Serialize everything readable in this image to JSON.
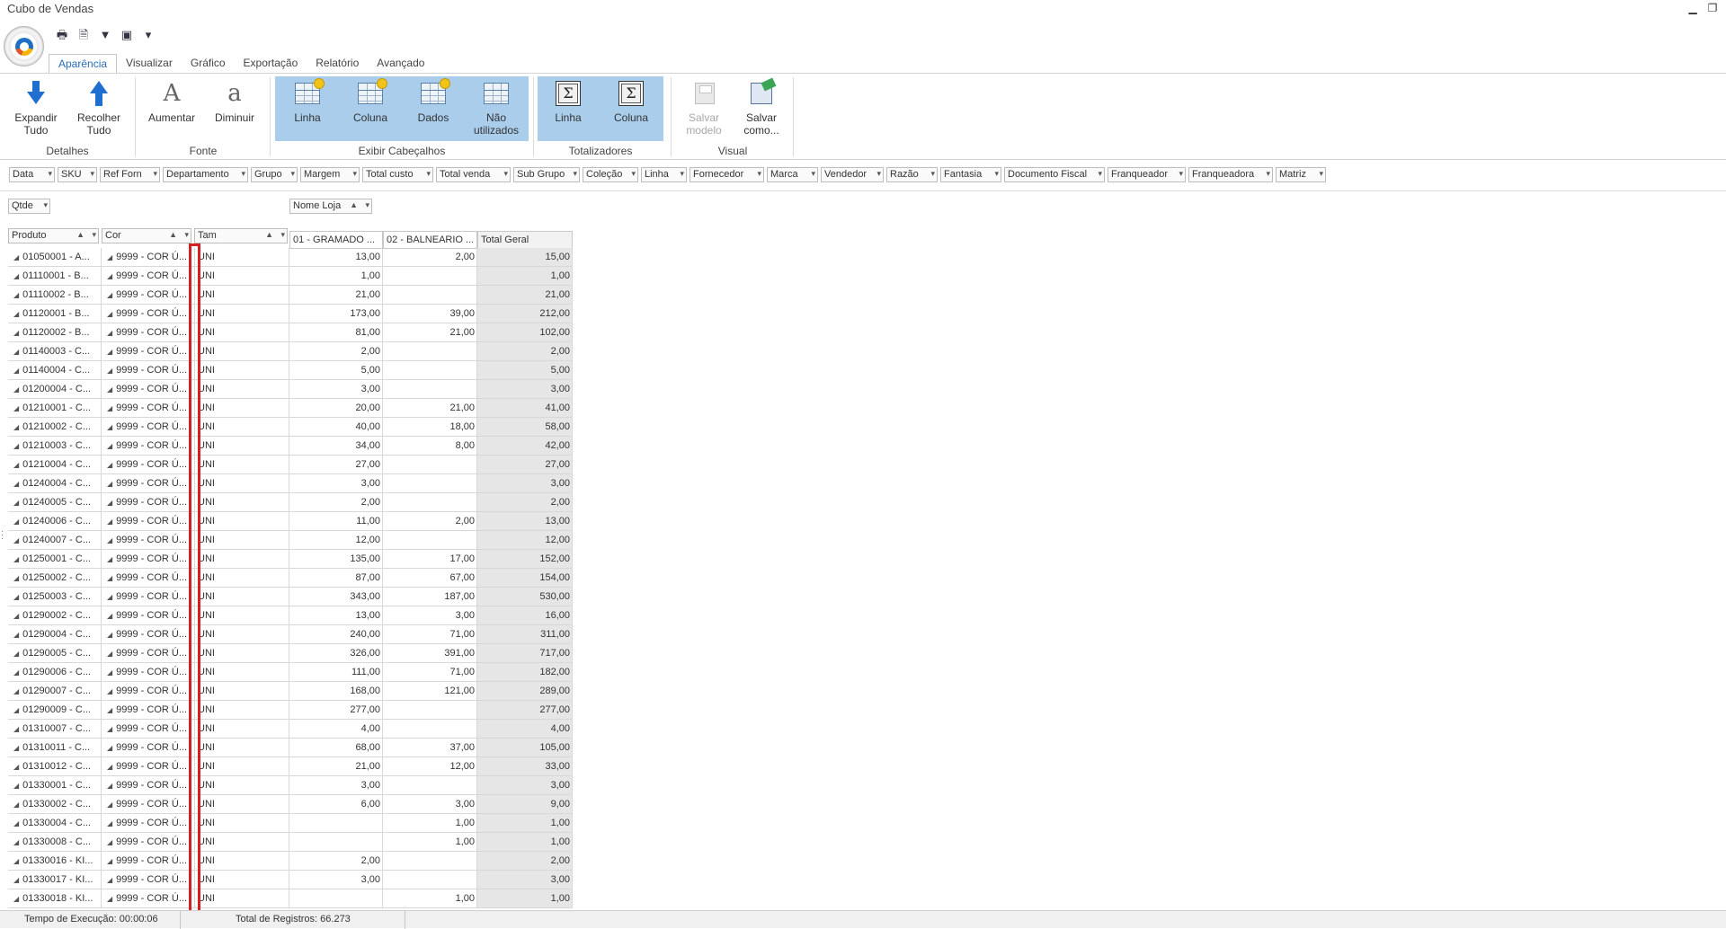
{
  "window": {
    "title": "Cubo de Vendas",
    "minimize_glyph": "▁",
    "restore_glyph": "❐"
  },
  "quick_access": [
    {
      "name": "print-icon",
      "glyph": "🖶"
    },
    {
      "name": "preview-icon",
      "glyph": "🗎"
    },
    {
      "name": "filter-icon",
      "glyph": "▼"
    },
    {
      "name": "export-icon",
      "glyph": "▣"
    },
    {
      "name": "customize-qat-icon",
      "glyph": "▾"
    }
  ],
  "tabs": [
    {
      "label": "Aparência",
      "active": true
    },
    {
      "label": "Visualizar"
    },
    {
      "label": "Gráfico"
    },
    {
      "label": "Exportação"
    },
    {
      "label": "Relatório"
    },
    {
      "label": "Avançado"
    }
  ],
  "ribbon": {
    "expand": {
      "l1": "Expandir",
      "l2": "Tudo"
    },
    "collapse": {
      "l1": "Recolher",
      "l2": "Tudo"
    },
    "grp_detalhes": "Detalhes",
    "increase": {
      "l1": "Aumentar"
    },
    "decrease": {
      "l1": "Diminuir"
    },
    "grp_fonte": "Fonte",
    "hdr_linha": "Linha",
    "hdr_coluna": "Coluna",
    "hdr_dados": "Dados",
    "hdr_nao": {
      "l1": "Não",
      "l2": "utilizados"
    },
    "grp_exibir": "Exibir Cabeçalhos",
    "tot_linha": "Linha",
    "tot_coluna": "Coluna",
    "grp_totalizadores": "Totalizadores",
    "save_model": {
      "l1": "Salvar",
      "l2": "modelo"
    },
    "save_as": {
      "l1": "Salvar",
      "l2": "como..."
    },
    "grp_visual": "Visual",
    "accent_color": "#a9cdeb"
  },
  "filter_fields": [
    "Data",
    "SKU",
    "Ref Forn",
    "Departamento",
    "Grupo",
    "Margem",
    "Total custo",
    "Total venda",
    "Sub Grupo",
    "Coleção",
    "Linha",
    "Fornecedor",
    "Marca",
    "Vendedor",
    "Razão",
    "Fantasia",
    "Documento Fiscal",
    "Franqueador",
    "Franqueadora",
    "Matriz"
  ],
  "data_field": "Qtde",
  "column_field": "Nome Loja",
  "row_fields": [
    "Produto",
    "Cor",
    "Tam"
  ],
  "column_headers": [
    "01 - GRAMADO    ...",
    "02 - BALNEARIO ...",
    "Total Geral"
  ],
  "rows": [
    [
      "01050001 - A...",
      "9999 - COR Ú...",
      "UNI",
      "13,00",
      "2,00",
      "15,00"
    ],
    [
      "01110001 - B...",
      "9999 - COR Ú...",
      "UNI",
      "1,00",
      "",
      "1,00"
    ],
    [
      "01110002 - B...",
      "9999 - COR Ú...",
      "UNI",
      "21,00",
      "",
      "21,00"
    ],
    [
      "01120001 - B...",
      "9999 - COR Ú...",
      "UNI",
      "173,00",
      "39,00",
      "212,00"
    ],
    [
      "01120002 - B...",
      "9999 - COR Ú...",
      "UNI",
      "81,00",
      "21,00",
      "102,00"
    ],
    [
      "01140003 - C...",
      "9999 - COR Ú...",
      "UNI",
      "2,00",
      "",
      "2,00"
    ],
    [
      "01140004 - C...",
      "9999 - COR Ú...",
      "UNI",
      "5,00",
      "",
      "5,00"
    ],
    [
      "01200004 - C...",
      "9999 - COR Ú...",
      "UNI",
      "3,00",
      "",
      "3,00"
    ],
    [
      "01210001 - C...",
      "9999 - COR Ú...",
      "UNI",
      "20,00",
      "21,00",
      "41,00"
    ],
    [
      "01210002 - C...",
      "9999 - COR Ú...",
      "UNI",
      "40,00",
      "18,00",
      "58,00"
    ],
    [
      "01210003 - C...",
      "9999 - COR Ú...",
      "UNI",
      "34,00",
      "8,00",
      "42,00"
    ],
    [
      "01210004 - C...",
      "9999 - COR Ú...",
      "UNI",
      "27,00",
      "",
      "27,00"
    ],
    [
      "01240004 - C...",
      "9999 - COR Ú...",
      "UNI",
      "3,00",
      "",
      "3,00"
    ],
    [
      "01240005 - C...",
      "9999 - COR Ú...",
      "UNI",
      "2,00",
      "",
      "2,00"
    ],
    [
      "01240006 - C...",
      "9999 - COR Ú...",
      "UNI",
      "11,00",
      "2,00",
      "13,00"
    ],
    [
      "01240007 - C...",
      "9999 - COR Ú...",
      "UNI",
      "12,00",
      "",
      "12,00"
    ],
    [
      "01250001 - C...",
      "9999 - COR Ú...",
      "UNI",
      "135,00",
      "17,00",
      "152,00"
    ],
    [
      "01250002 - C...",
      "9999 - COR Ú...",
      "UNI",
      "87,00",
      "67,00",
      "154,00"
    ],
    [
      "01250003 - C...",
      "9999 - COR Ú...",
      "UNI",
      "343,00",
      "187,00",
      "530,00"
    ],
    [
      "01290002 - C...",
      "9999 - COR Ú...",
      "UNI",
      "13,00",
      "3,00",
      "16,00"
    ],
    [
      "01290004 - C...",
      "9999 - COR Ú...",
      "UNI",
      "240,00",
      "71,00",
      "311,00"
    ],
    [
      "01290005 - C...",
      "9999 - COR Ú...",
      "UNI",
      "326,00",
      "391,00",
      "717,00"
    ],
    [
      "01290006 - C...",
      "9999 - COR Ú...",
      "UNI",
      "111,00",
      "71,00",
      "182,00"
    ],
    [
      "01290007 - C...",
      "9999 - COR Ú...",
      "UNI",
      "168,00",
      "121,00",
      "289,00"
    ],
    [
      "01290009 - C...",
      "9999 - COR Ú...",
      "UNI",
      "277,00",
      "",
      "277,00"
    ],
    [
      "01310007 - C...",
      "9999 - COR Ú...",
      "UNI",
      "4,00",
      "",
      "4,00"
    ],
    [
      "01310011 - C...",
      "9999 - COR Ú...",
      "UNI",
      "68,00",
      "37,00",
      "105,00"
    ],
    [
      "01310012 - C...",
      "9999 - COR Ú...",
      "UNI",
      "21,00",
      "12,00",
      "33,00"
    ],
    [
      "01330001 - C...",
      "9999 - COR Ú...",
      "UNI",
      "3,00",
      "",
      "3,00"
    ],
    [
      "01330002 - C...",
      "9999 - COR Ú...",
      "UNI",
      "6,00",
      "3,00",
      "9,00"
    ],
    [
      "01330004 - C...",
      "9999 - COR Ú...",
      "UNI",
      "",
      "1,00",
      "1,00"
    ],
    [
      "01330008 - C...",
      "9999 - COR Ú...",
      "UNI",
      "",
      "1,00",
      "1,00"
    ],
    [
      "01330016 - KI...",
      "9999 - COR Ú...",
      "UNI",
      "2,00",
      "",
      "2,00"
    ],
    [
      "01330017 - KI...",
      "9999 - COR Ú...",
      "UNI",
      "3,00",
      "",
      "3,00"
    ],
    [
      "01330018 - KI...",
      "9999 - COR Ú...",
      "UNI",
      "",
      "1,00",
      "1,00"
    ]
  ],
  "status": {
    "exec_time": "Tempo de Execução: 00:00:06",
    "total_records": "Total de Registros: 66.273"
  },
  "highlight_color": "#d42020"
}
